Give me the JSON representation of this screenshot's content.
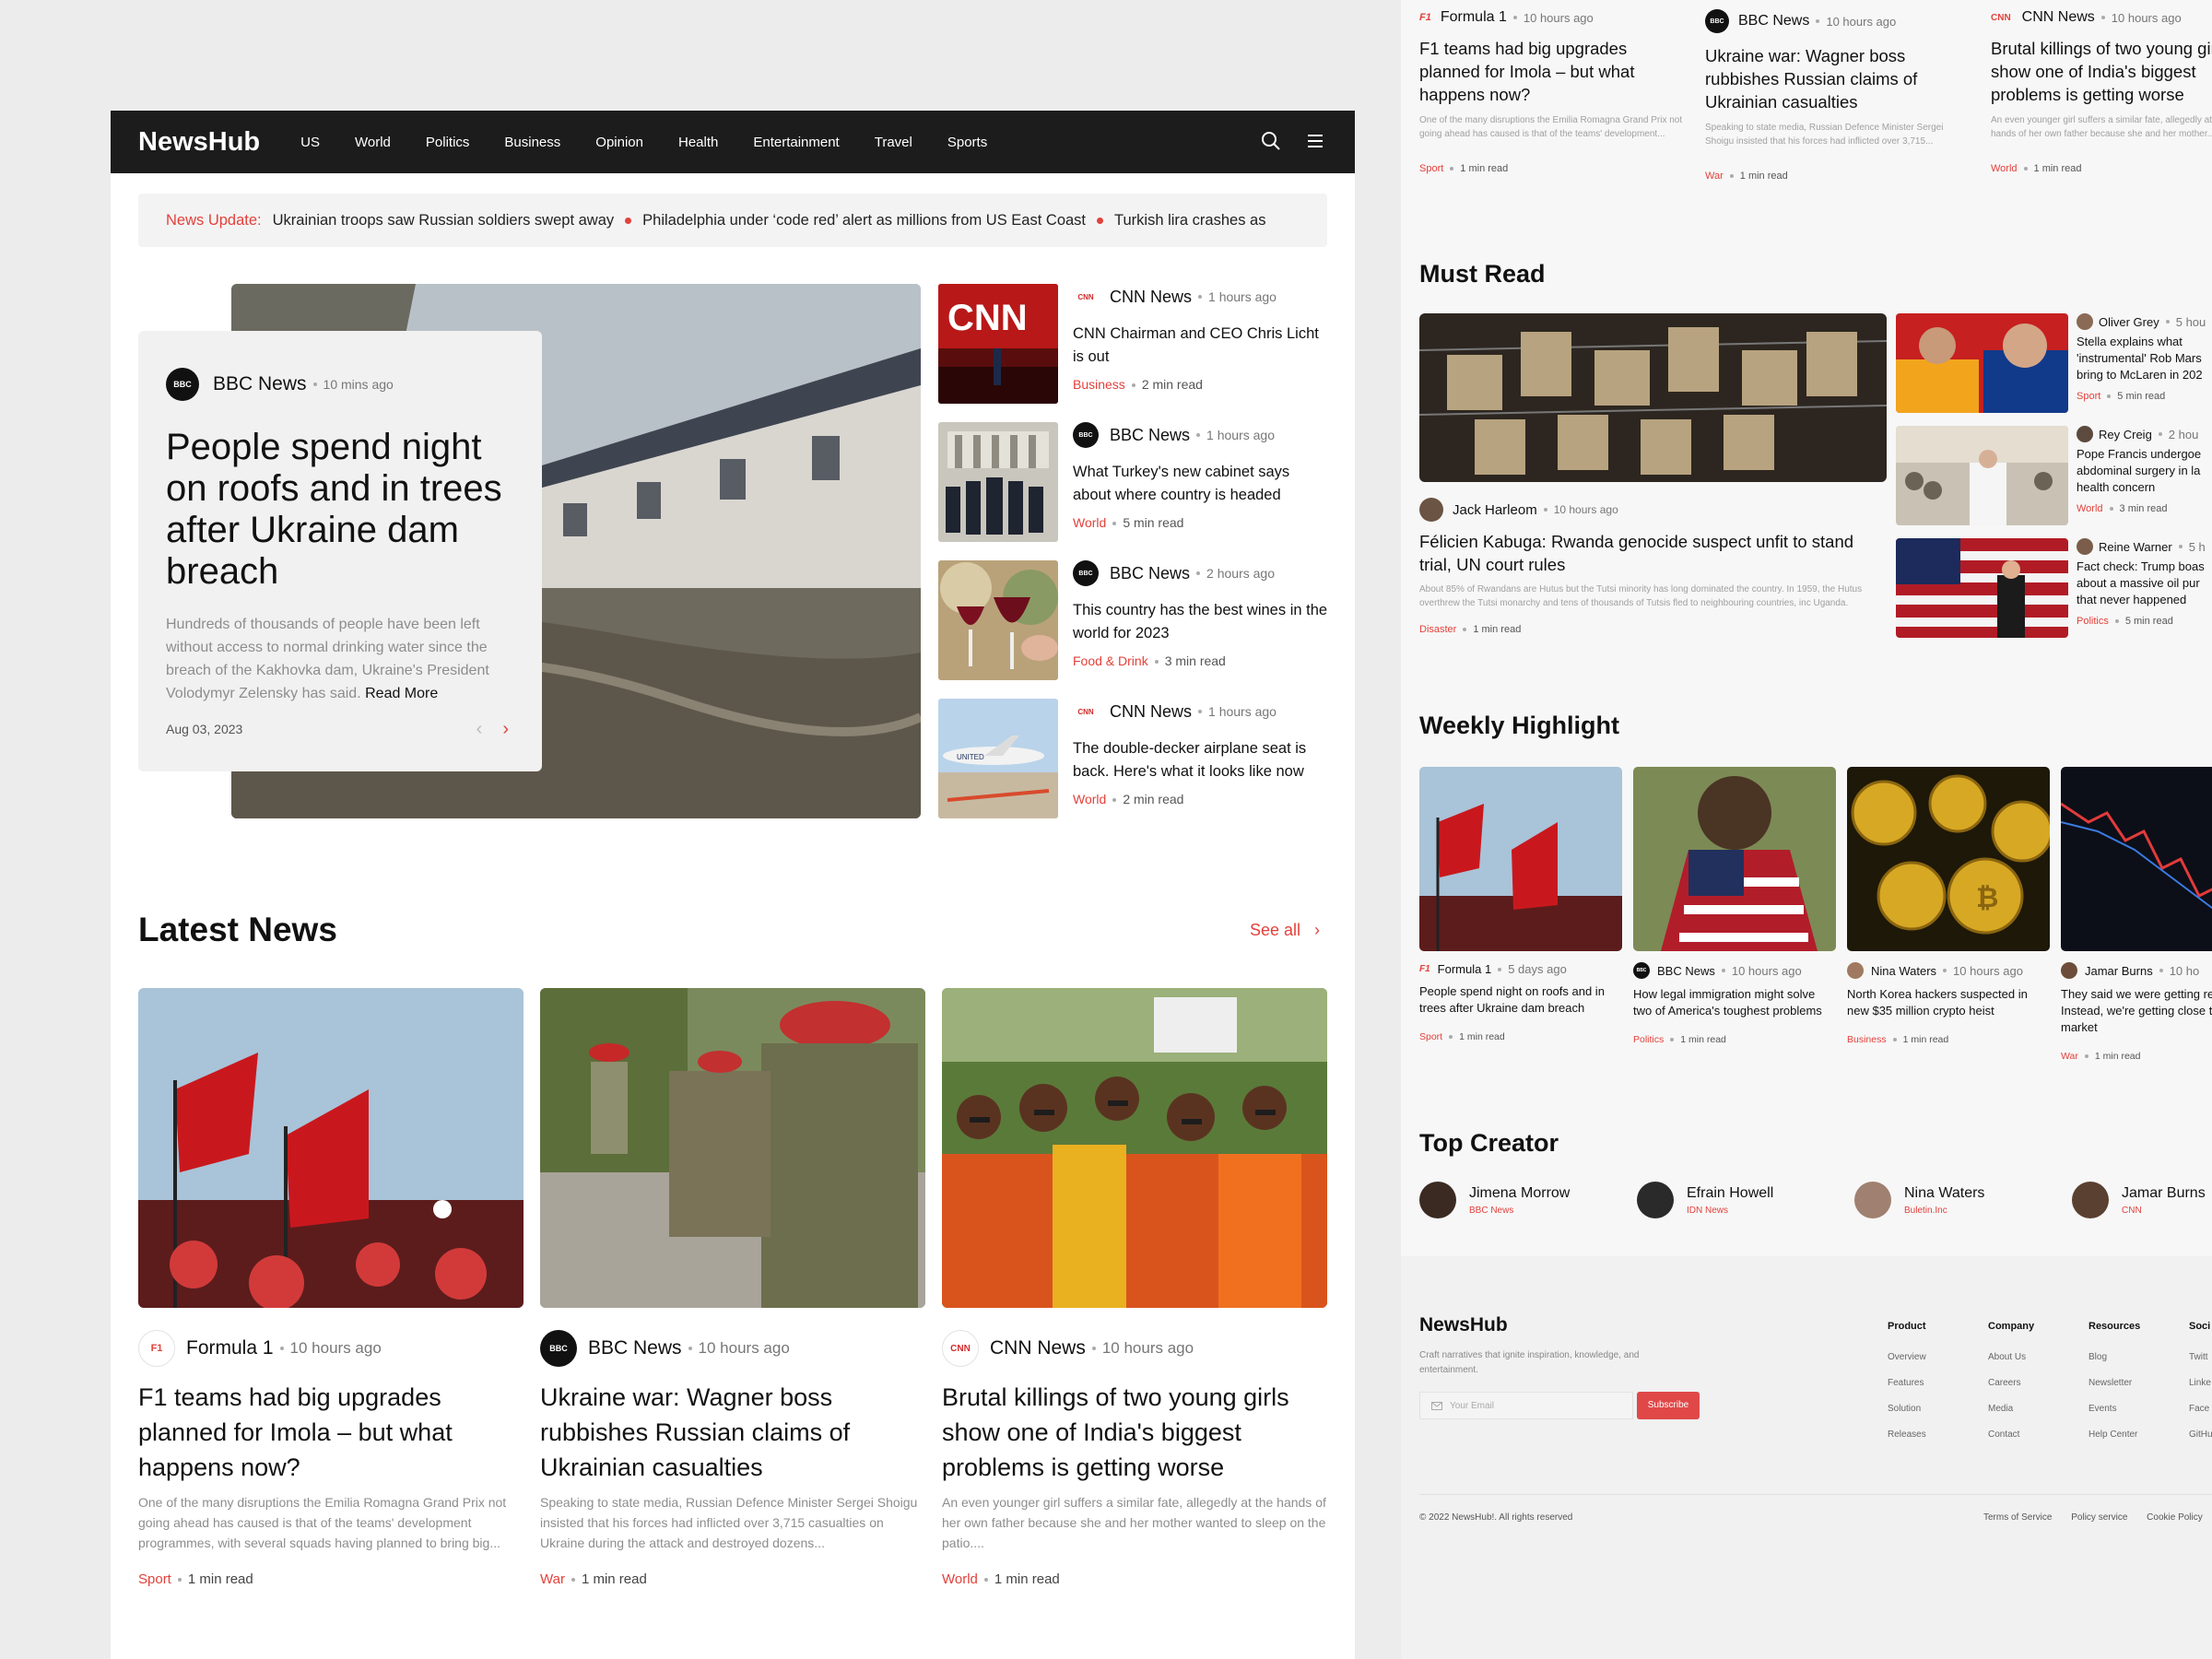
{
  "nav": {
    "brand": "NewsHub",
    "items": [
      "US",
      "World",
      "Politics",
      "Business",
      "Opinion",
      "Health",
      "Entertainment",
      "Travel",
      "Sports"
    ]
  },
  "ticker": {
    "label": "News Update:",
    "items": [
      "Ukrainian troops saw Russian soldiers swept away",
      "Philadelphia under ‘code red’ alert as millions from US East Coast",
      "Turkish lira crashes as"
    ]
  },
  "hero": {
    "source": "BBC News",
    "time": "10 mins ago",
    "title": "People spend night on roofs and in trees after Ukraine dam breach",
    "summary": "Hundreds of thousands of people have been left without access to normal drinking water since the breach of the Kakhovka dam, Ukraine's President Volodymyr Zelensky has said.",
    "read_more": "Read More",
    "date": "Aug 03, 2023"
  },
  "side_news": [
    {
      "source": "CNN News",
      "time": "1 hours ago",
      "title": "CNN Chairman and CEO Chris Licht is out",
      "category": "Business",
      "read": "2 min read"
    },
    {
      "source": "BBC News",
      "time": "1 hours ago",
      "title": "What Turkey's new cabinet says about where country is headed",
      "category": "World",
      "read": "5 min read"
    },
    {
      "source": "BBC News",
      "time": "2 hours ago",
      "title": "This country has the best wines in the world for 2023",
      "category": "Food & Drink",
      "read": "3 min read"
    },
    {
      "source": "CNN News",
      "time": "1 hours ago",
      "title": "The double-decker airplane seat is back. Here's what it looks like now",
      "category": "World",
      "read": "2 min read"
    }
  ],
  "latest": {
    "heading": "Latest News",
    "see_all": "See all",
    "cards": [
      {
        "source": "Formula 1",
        "time": "10 hours ago",
        "title": "F1 teams had big upgrades planned for Imola – but what happens now?",
        "summary": "One of the many disruptions the Emilia Romagna Grand Prix not going ahead has caused is that of the teams' development programmes, with several squads having planned to bring big...",
        "category": "Sport",
        "read": "1 min read"
      },
      {
        "source": "BBC News",
        "time": "10 hours ago",
        "title": "Ukraine war: Wagner boss rubbishes Russian claims of Ukrainian casualties",
        "summary": "Speaking to state media, Russian Defence Minister Sergei Shoigu insisted that his forces had inflicted over 3,715 casualties on Ukraine during the attack and destroyed dozens...",
        "category": "War",
        "read": "1 min read"
      },
      {
        "source": "CNN News",
        "time": "10 hours ago",
        "title": "Brutal killings of two young girls show one of India's biggest problems is getting worse",
        "summary": "An even younger girl suffers a similar fate, allegedly at the hands of her own father because she and her mother wanted to sleep on the patio....",
        "category": "World",
        "read": "1 min read"
      }
    ]
  },
  "right_top": [
    {
      "source": "Formula 1",
      "time": "10 hours ago",
      "title": "F1 teams had big upgrades planned for Imola – but what happens now?",
      "summary": "One of the many disruptions the Emilia Romagna Grand Prix not going ahead has caused is that of the teams' development...",
      "category": "Sport",
      "read": "1 min read"
    },
    {
      "source": "BBC News",
      "time": "10 hours ago",
      "title": "Ukraine war: Wagner boss rubbishes Russian claims of Ukrainian casualties",
      "summary": "Speaking to state media, Russian Defence Minister Sergei Shoigu insisted that his forces had inflicted over 3,715...",
      "category": "War",
      "read": "1 min read"
    },
    {
      "source": "CNN News",
      "time": "10 hours ago",
      "title": "Brutal killings of two young girls show one of India's biggest problems is getting worse",
      "summary": "An even younger girl suffers a similar fate, allegedly at the hands of her own father because she and her mother...",
      "category": "World",
      "read": "1 min read"
    }
  ],
  "must_read": {
    "heading": "Must Read",
    "main": {
      "author": "Jack Harleom",
      "time": "10 hours ago",
      "title": "Félicien Kabuga: Rwanda genocide suspect unfit to stand trial, UN court rules",
      "summary": "About 85% of Rwandans are Hutus but the Tutsi minority has long dominated the country. In 1959, the Hutus overthrew the Tutsi monarchy and tens of thousands of Tutsis fled to neighbouring countries, inc Uganda.",
      "category": "Disaster",
      "read": "1 min read"
    },
    "items": [
      {
        "author": "Oliver Grey",
        "time": "5 hou",
        "title_lines": [
          "Stella explains what",
          "'instrumental' Rob Mars",
          "bring to McLaren in 202"
        ],
        "category": "Sport",
        "read": "5 min read"
      },
      {
        "author": "Rey Creig",
        "time": "2 hou",
        "title_lines": [
          "Pope Francis undergoe",
          "abdominal surgery in la",
          "health concern"
        ],
        "category": "World",
        "read": "3 min read"
      },
      {
        "author": "Reine Warner",
        "time": "5 h",
        "title_lines": [
          "Fact check: Trump boas",
          "about a massive oil pur",
          "that never happened"
        ],
        "category": "Politics",
        "read": "5 min read"
      }
    ]
  },
  "weekly": {
    "heading": "Weekly Highlight",
    "items": [
      {
        "source": "Formula 1",
        "time": "5 days ago",
        "title": "People spend night on roofs and in trees after Ukraine dam breach",
        "category": "Sport",
        "read": "1 min read"
      },
      {
        "source": "BBC News",
        "time": "10 hours ago",
        "title": "How legal immigration might solve two of America's toughest problems",
        "category": "Politics",
        "read": "1 min read"
      },
      {
        "source": "Nina Waters",
        "time": "10 hours ago",
        "title": "North Korea hackers suspected in new $35 million crypto heist",
        "category": "Business",
        "read": "1 min read"
      },
      {
        "source": "Jamar Burns",
        "time": "10 ho",
        "title": "They said we were getting recession. Instead, we're getting close to a bull market",
        "category": "War",
        "read": "1 min read"
      }
    ]
  },
  "creators": {
    "heading": "Top Creator",
    "items": [
      {
        "name": "Jimena Morrow",
        "org": "BBC News"
      },
      {
        "name": "Efrain Howell",
        "org": "IDN News"
      },
      {
        "name": "Nina Waters",
        "org": "Buletin.Inc"
      },
      {
        "name": "Jamar Burns",
        "org": "CNN"
      }
    ]
  },
  "footer": {
    "brand": "NewsHub",
    "tagline": "Craft narratives that ignite inspiration, knowledge, and entertainment.",
    "email_placeholder": "Your Email",
    "subscribe": "Subscribe",
    "columns": [
      {
        "heading": "Product",
        "links": [
          "Overview",
          "Features",
          "Solution",
          "Releases"
        ]
      },
      {
        "heading": "Company",
        "links": [
          "About Us",
          "Careers",
          "Media",
          "Contact"
        ]
      },
      {
        "heading": "Resources",
        "links": [
          "Blog",
          "Newsletter",
          "Events",
          "Help Center"
        ]
      },
      {
        "heading": "Soci",
        "links": [
          "Twitt",
          "Linke",
          "Face",
          "GitHu"
        ]
      }
    ],
    "copyright": "© 2022 NewsHub!. All rights reserved",
    "legal": [
      "Terms of Service",
      "Policy service",
      "Cookie Policy"
    ]
  },
  "colors": {
    "accent": "#e3413b",
    "nav_bg": "#1c1c1c",
    "page_bg": "#ececec"
  }
}
